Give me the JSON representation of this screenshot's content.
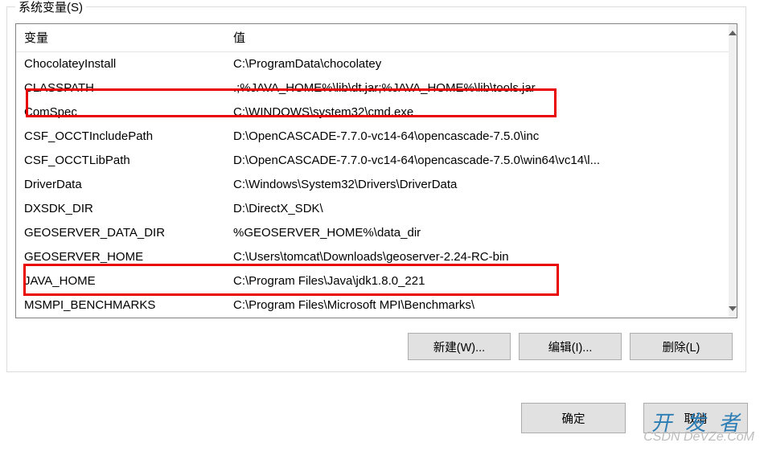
{
  "group_label": "系统变量(S)",
  "columns": {
    "var": "变量",
    "val": "值"
  },
  "rows": [
    {
      "var": "ChocolateyInstall",
      "val": "C:\\ProgramData\\chocolatey"
    },
    {
      "var": "CLASSPATH",
      "val": ".;%JAVA_HOME%\\lib\\dt.jar;%JAVA_HOME%\\lib\\tools.jar"
    },
    {
      "var": "ComSpec",
      "val": "C:\\WINDOWS\\system32\\cmd.exe"
    },
    {
      "var": "CSF_OCCTIncludePath",
      "val": "D:\\OpenCASCADE-7.7.0-vc14-64\\opencascade-7.5.0\\inc"
    },
    {
      "var": "CSF_OCCTLibPath",
      "val": "D:\\OpenCASCADE-7.7.0-vc14-64\\opencascade-7.5.0\\win64\\vc14\\l..."
    },
    {
      "var": "DriverData",
      "val": "C:\\Windows\\System32\\Drivers\\DriverData"
    },
    {
      "var": "DXSDK_DIR",
      "val": "D:\\DirectX_SDK\\"
    },
    {
      "var": "GEOSERVER_DATA_DIR",
      "val": "%GEOSERVER_HOME%\\data_dir"
    },
    {
      "var": "GEOSERVER_HOME",
      "val": "C:\\Users\\tomcat\\Downloads\\geoserver-2.24-RC-bin"
    },
    {
      "var": "JAVA_HOME",
      "val": "C:\\Program Files\\Java\\jdk1.8.0_221"
    },
    {
      "var": "MSMPI_BENCHMARKS",
      "val": "C:\\Program Files\\Microsoft MPI\\Benchmarks\\"
    }
  ],
  "buttons": {
    "new": "新建(W)...",
    "edit": "编辑(I)...",
    "delete": "删除(L)"
  },
  "dialog_buttons": {
    "ok": "确定",
    "cancel": "取消"
  },
  "watermark": {
    "line1": "开发者",
    "line2": "CSDN DeVZe.CoM"
  }
}
